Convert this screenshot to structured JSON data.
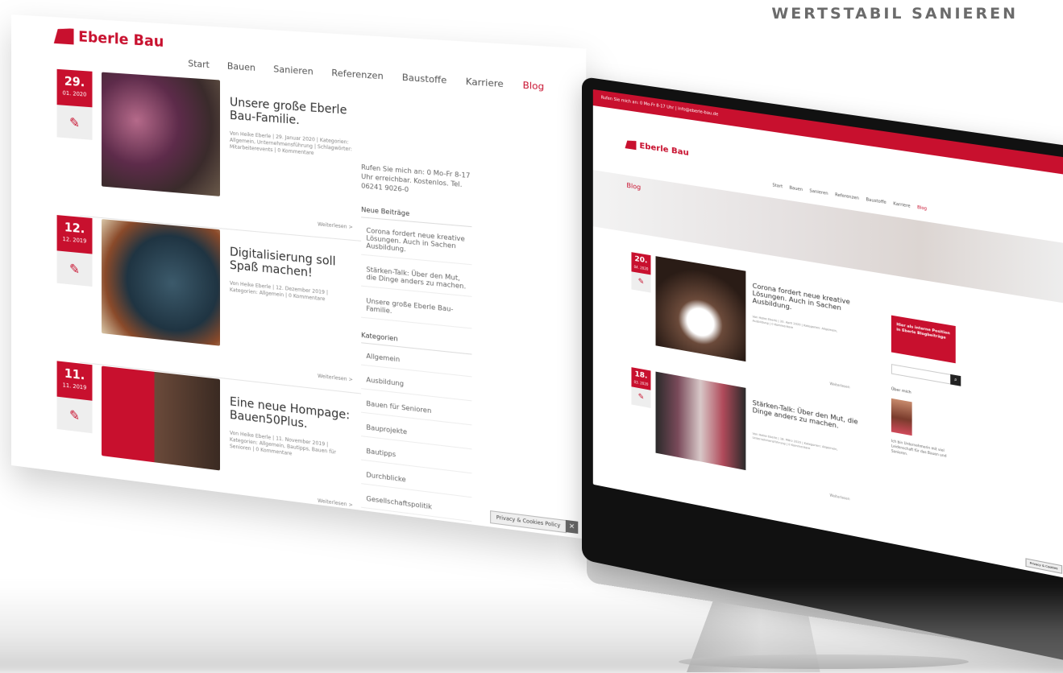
{
  "tagline": "WERTSTABIL SANIEREN",
  "brand": {
    "name": "Eberle Bau",
    "color": "#c8102e"
  },
  "left_page": {
    "nav": [
      {
        "label": "Start",
        "active": false
      },
      {
        "label": "Bauen",
        "active": false
      },
      {
        "label": "Sanieren",
        "active": false
      },
      {
        "label": "Referenzen",
        "active": false
      },
      {
        "label": "Baustoffe",
        "active": false
      },
      {
        "label": "Karriere",
        "active": false
      },
      {
        "label": "Blog",
        "active": true
      }
    ],
    "posts": [
      {
        "day": "29.",
        "month": "01. 2020",
        "title": "Unsere große Eberle Bau-Familie.",
        "meta": "Von Heike Eberle | 29. Januar 2020 | Kategorien: Allgemein, Unternehmensführung | Schlagwörter: Mitarbeiterevents | 0 Kommentare",
        "more": "Weiterlesen >"
      },
      {
        "day": "12.",
        "month": "12. 2019",
        "title": "Digitalisierung soll Spaß machen!",
        "meta": "Von Heike Eberle | 12. Dezember 2019 | Kategorien: Allgemein | 0 Kommentare",
        "more": "Weiterlesen >"
      },
      {
        "day": "11.",
        "month": "11. 2019",
        "title": "Eine neue Hompage: Bauen50Plus.",
        "meta": "Von Heike Eberle | 11. November 2019 | Kategorien: Allgemein, Bautipps, Bauen für Senioren | 0 Kommentare",
        "more": "Weiterlesen >"
      }
    ],
    "sidebar": {
      "intro": "Rufen Sie mich an: 0 Mo-Fr 8-17 Uhr erreichbar. Kostenlos. Tel. 06241 9026-0",
      "recent_title": "Neue Beiträge",
      "recent": [
        "Corona fordert neue kreative Lösungen. Auch in Sachen Ausbildung.",
        "Stärken-Talk: Über den Mut, die Dinge anders zu machen.",
        "Unsere große Eberle Bau-Familie."
      ],
      "categories_title": "Kategorien",
      "categories": [
        "Allgemein",
        "Ausbildung",
        "Bauen für Senioren",
        "Bauprojekte",
        "Bautipps",
        "Durchblicke",
        "Gesellschaftspolitik"
      ]
    },
    "cookie_label": "Privacy & Cookies Policy"
  },
  "imac": {
    "topbar": "Rufen Sie mich an: 0 Mo-Fr 8-17 Uhr | info@eberle-bau.de",
    "nav": [
      {
        "label": "Start",
        "active": false
      },
      {
        "label": "Bauen",
        "active": false
      },
      {
        "label": "Sanieren",
        "active": false
      },
      {
        "label": "Referenzen",
        "active": false
      },
      {
        "label": "Baustoffe",
        "active": false
      },
      {
        "label": "Karriere",
        "active": false
      },
      {
        "label": "Blog",
        "active": true
      }
    ],
    "hero_title": "Blog",
    "posts": [
      {
        "day": "20.",
        "month": "04. 2020",
        "title": "Corona fordert neue kreative Lösungen. Auch in Sachen Ausbildung.",
        "meta": "Von Heike Eberle | 20. April 2020 | Kategorien: Allgemein, Ausbildung | 0 Kommentare",
        "more": "Weiterlesen"
      },
      {
        "day": "18.",
        "month": "03. 2020",
        "title": "Stärken-Talk: Über den Mut, die Dinge anders zu machen.",
        "meta": "Von Heike Eberle | 18. März 2020 | Kategorien: Allgemein, Unternehmensführung | 0 Kommentare",
        "more": "Weiterlesen"
      }
    ],
    "cta": "Hier als interne Position in Eberle Blogbeiträge",
    "search_placeholder": "",
    "about_title": "Über mich",
    "about_text": "Ich bin Unternehmerin mit viel Leidenschaft für das Bauen und Sanieren.",
    "cookie_label": "Privacy & Cookies"
  }
}
